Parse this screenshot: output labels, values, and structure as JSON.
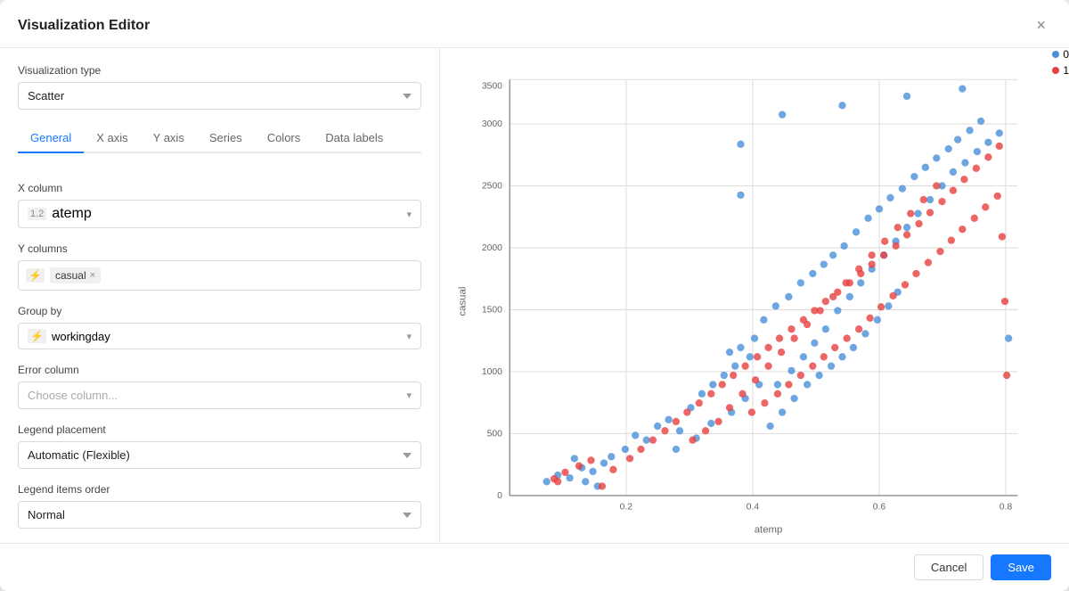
{
  "modal": {
    "title": "Visualization Editor",
    "close_label": "×"
  },
  "viz_type": {
    "label": "Visualization type",
    "value": "Scatter",
    "icon": "⠿"
  },
  "tabs": [
    {
      "label": "General",
      "active": true
    },
    {
      "label": "X axis",
      "active": false
    },
    {
      "label": "Y axis",
      "active": false
    },
    {
      "label": "Series",
      "active": false
    },
    {
      "label": "Colors",
      "active": false
    },
    {
      "label": "Data labels",
      "active": false
    }
  ],
  "x_column": {
    "label": "X column",
    "col_type": "1.2",
    "value": "atemp"
  },
  "y_columns": {
    "label": "Y columns",
    "tags": [
      {
        "col_type": "⚡",
        "value": "casual"
      }
    ]
  },
  "group_by": {
    "label": "Group by",
    "col_type": "⚡",
    "value": "workingday"
  },
  "error_column": {
    "label": "Error column",
    "placeholder": "Choose column..."
  },
  "legend_placement": {
    "label": "Legend placement",
    "value": "Automatic (Flexible)"
  },
  "legend_items_order": {
    "label": "Legend items order",
    "value": "Normal"
  },
  "chart": {
    "x_label": "atemp",
    "y_label": "casual",
    "x_ticks": [
      "0.2",
      "0.4",
      "0.6",
      "0.8"
    ],
    "y_ticks": [
      "0",
      "500",
      "1000",
      "1500",
      "2000",
      "2500",
      "3000",
      "3500"
    ],
    "legend": [
      {
        "label": "0",
        "color": "#4a90d9"
      },
      {
        "label": "1",
        "color": "#e84040"
      }
    ]
  },
  "footer": {
    "cancel_label": "Cancel",
    "save_label": "Save"
  }
}
